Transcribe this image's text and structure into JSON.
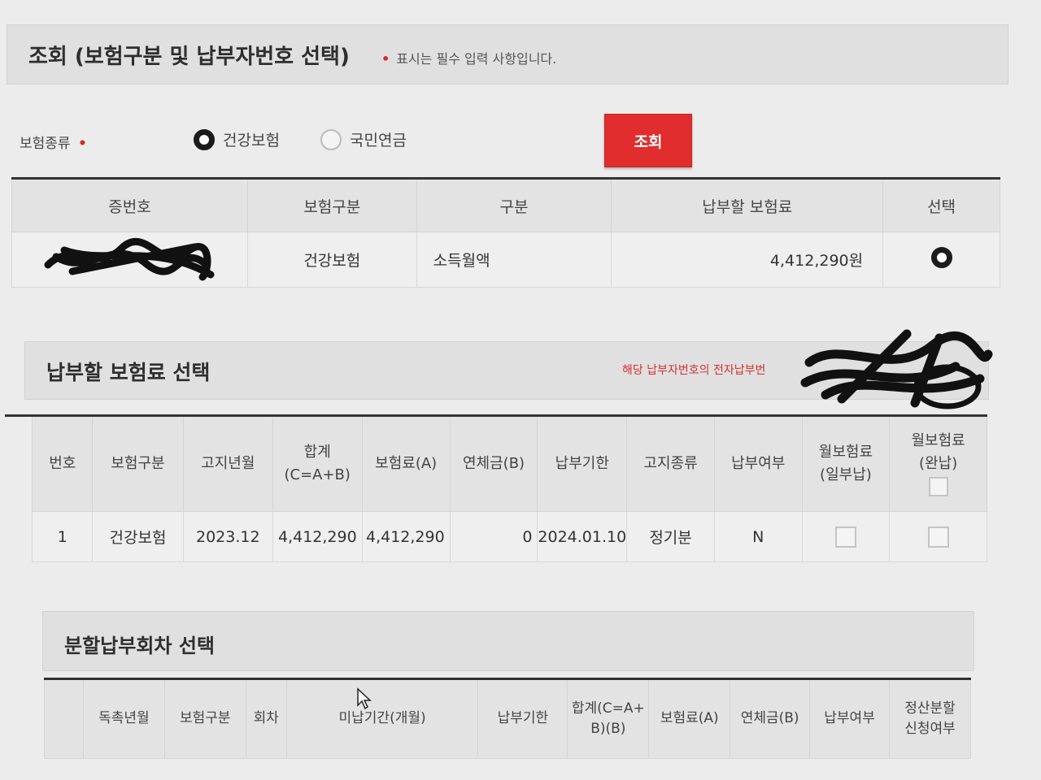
{
  "inquiry": {
    "title": "조회 (보험구분 및 납부자번호 선택)",
    "required_mark": "•",
    "required_note": "표시는 필수 입력 사항입니다.",
    "insurance_type_label": "보험종류",
    "options": [
      {
        "label": "건강보험",
        "selected": true
      },
      {
        "label": "국민연금",
        "selected": false
      }
    ],
    "search_button": "조회"
  },
  "policy_table": {
    "headers": [
      "증번호",
      "보험구분",
      "구분",
      "납부할 보험료",
      "선택"
    ],
    "rows": [
      {
        "insurance": "건강보험",
        "category": "소득월액",
        "amount": "4,412,290원",
        "selected": true
      }
    ]
  },
  "premium_section": {
    "title": "납부할 보험료 선택",
    "notice": "해당 납부자번호의 전자납부번"
  },
  "premium_table": {
    "headers": [
      "번호",
      "보험구분",
      "고지년월",
      "합계\n(C=A+B)",
      "보험료(A)",
      "연체금(B)",
      "납부기한",
      "고지종류",
      "납부여부",
      "월보험료\n(일부납)",
      "월보험료\n(완납)"
    ],
    "rows": [
      {
        "no": "1",
        "insurance": "건강보험",
        "notice_month": "2023.12",
        "total": "4,412,290",
        "premium": "4,412,290",
        "late_fee": "0",
        "due_date": "2024.01.10",
        "notice_type": "정기분",
        "paid": "N"
      }
    ]
  },
  "installment_section": {
    "title": "분할납부회차 선택",
    "headers": [
      "",
      "독촉년월",
      "보험구분",
      "회차",
      "미납기간(개월)",
      "납부기한",
      "합계(C=A+\nB)(B)",
      "보험료(A)",
      "연체금(B)",
      "납부여부",
      "정산분할\n신청여부"
    ]
  },
  "colors": {
    "accent_red": "#e12d2d",
    "header_bg": "#e0e0e0",
    "notice_red": "#d63030"
  },
  "icons": {
    "selected_radio": "radio-selected-icon",
    "checkbox": "checkbox-icon",
    "cursor": "mouse-pointer-icon"
  }
}
